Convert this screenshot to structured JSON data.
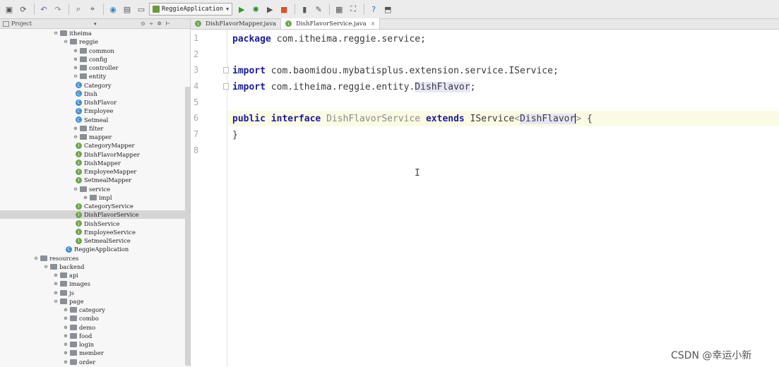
{
  "toolbar": {
    "icons": [
      "save-icon",
      "sync-icon",
      "undo-icon",
      "redo-icon",
      "find-icon",
      "replace-icon",
      "make-icon",
      "build-icon",
      "folder-icon",
      "run-icon",
      "debug-icon",
      "coverage-icon",
      "stop-icon",
      "vcs-icon",
      "settings-icon",
      "structure-icon",
      "sdk-icon",
      "help-icon",
      "plugin-icon"
    ],
    "run_config_label": "ReggieApplication"
  },
  "project": {
    "title": "Project"
  },
  "tree": [
    {
      "label": "itheima",
      "type": "folder",
      "exp": "⊖",
      "depth": 0
    },
    {
      "label": "reggie",
      "type": "folder",
      "exp": "⊖",
      "depth": 1
    },
    {
      "label": "common",
      "type": "folder",
      "exp": "⊕",
      "depth": 2
    },
    {
      "label": "config",
      "type": "folder",
      "exp": "⊕",
      "depth": 2
    },
    {
      "label": "controller",
      "type": "folder",
      "exp": "⊕",
      "depth": 2
    },
    {
      "label": "entity",
      "type": "folder",
      "exp": "⊖",
      "depth": 2
    },
    {
      "label": "Category",
      "type": "class",
      "exp": "",
      "depth": 3
    },
    {
      "label": "Dish",
      "type": "class",
      "exp": "",
      "depth": 3
    },
    {
      "label": "DishFlavor",
      "type": "class",
      "exp": "",
      "depth": 3
    },
    {
      "label": "Employee",
      "type": "class",
      "exp": "",
      "depth": 3
    },
    {
      "label": "Setmeal",
      "type": "class",
      "exp": "",
      "depth": 3
    },
    {
      "label": "filter",
      "type": "folder",
      "exp": "⊕",
      "depth": 2
    },
    {
      "label": "mapper",
      "type": "folder",
      "exp": "⊖",
      "depth": 2
    },
    {
      "label": "CategoryMapper",
      "type": "interface",
      "exp": "",
      "depth": 3
    },
    {
      "label": "DishFlavorMapper",
      "type": "interface",
      "exp": "",
      "depth": 3
    },
    {
      "label": "DishMapper",
      "type": "interface",
      "exp": "",
      "depth": 3
    },
    {
      "label": "EmployeeMapper",
      "type": "interface",
      "exp": "",
      "depth": 3
    },
    {
      "label": "SetmealMapper",
      "type": "interface",
      "exp": "",
      "depth": 3
    },
    {
      "label": "service",
      "type": "folder",
      "exp": "⊖",
      "depth": 2
    },
    {
      "label": "impl",
      "type": "folder",
      "exp": "⊕",
      "depth": 3
    },
    {
      "label": "CategoryService",
      "type": "interface",
      "exp": "",
      "depth": 3
    },
    {
      "label": "DishFlavorService",
      "type": "interface",
      "exp": "",
      "depth": 3,
      "selected": true
    },
    {
      "label": "DishService",
      "type": "interface",
      "exp": "",
      "depth": 3
    },
    {
      "label": "EmployeeService",
      "type": "interface",
      "exp": "",
      "depth": 3
    },
    {
      "label": "SetmealService",
      "type": "interface",
      "exp": "",
      "depth": 3
    },
    {
      "label": "ReggieApplication",
      "type": "class",
      "exp": "",
      "depth": 2
    },
    {
      "label": "resources",
      "type": "folder",
      "exp": "⊖",
      "depth": -2
    },
    {
      "label": "backend",
      "type": "folder",
      "exp": "⊖",
      "depth": -1
    },
    {
      "label": "api",
      "type": "folder",
      "exp": "⊕",
      "depth": 0
    },
    {
      "label": "images",
      "type": "folder",
      "exp": "⊕",
      "depth": 0
    },
    {
      "label": "js",
      "type": "folder",
      "exp": "⊕",
      "depth": 0
    },
    {
      "label": "page",
      "type": "folder",
      "exp": "⊖",
      "depth": 0
    },
    {
      "label": "category",
      "type": "folder",
      "exp": "⊕",
      "depth": 1
    },
    {
      "label": "combo",
      "type": "folder",
      "exp": "⊕",
      "depth": 1
    },
    {
      "label": "demo",
      "type": "folder",
      "exp": "⊕",
      "depth": 1
    },
    {
      "label": "food",
      "type": "folder",
      "exp": "⊕",
      "depth": 1
    },
    {
      "label": "login",
      "type": "folder",
      "exp": "⊕",
      "depth": 1
    },
    {
      "label": "member",
      "type": "folder",
      "exp": "⊕",
      "depth": 1
    },
    {
      "label": "order",
      "type": "folder",
      "exp": "⊕",
      "depth": 1
    }
  ],
  "tabs": [
    {
      "label": "DishFlavorMapper.java",
      "active": false
    },
    {
      "label": "DishFlavorService.java",
      "active": true,
      "close": "×"
    }
  ],
  "editor": {
    "line_numbers": [
      "1",
      "2",
      "3",
      "4",
      "5",
      "6",
      "7",
      "8"
    ],
    "line1": {
      "kw": "package",
      "rest": " com.itheima.reggie.service;"
    },
    "line3": {
      "kw": "import",
      "rest": " com.baomidou.mybatisplus.extension.service.IService;"
    },
    "line4": {
      "kw": "import",
      "rest": " com.itheima.reggie.entity.",
      "type": "DishFlavor",
      ";": ";"
    },
    "line6": {
      "kw1": "public",
      "kw2": "interface",
      "name": "DishFlavorService",
      "kw3": "extends",
      "base": "IService",
      "lt": "<",
      "param": "DishFlavor",
      "gt": ">",
      "brace": " {"
    },
    "line7": "}"
  },
  "text_cursor": "I",
  "watermark": "CSDN @幸运小新"
}
